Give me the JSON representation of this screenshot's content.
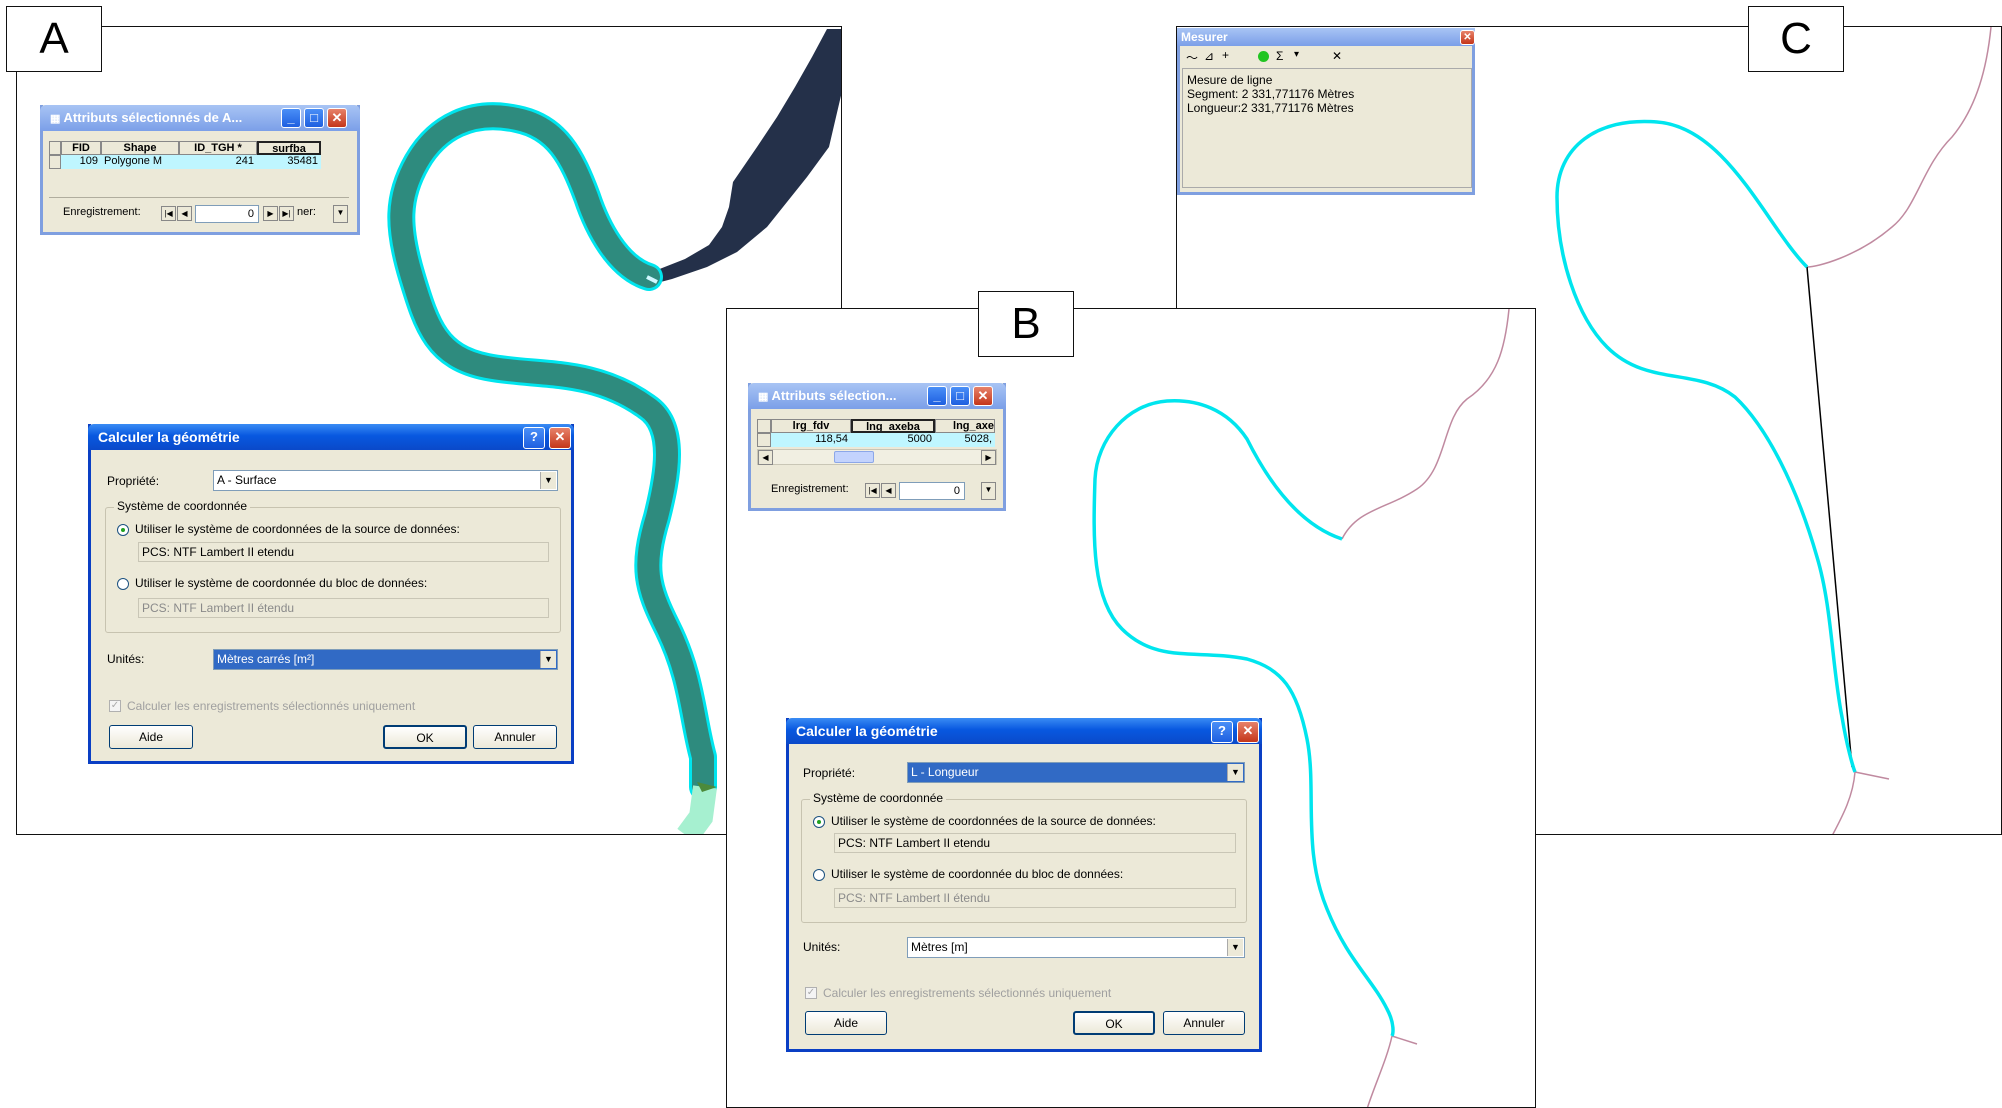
{
  "panels": {
    "a": {
      "letter": "A"
    },
    "b": {
      "letter": "B"
    },
    "c": {
      "letter": "C"
    }
  },
  "attr_a": {
    "title": "Attributs sélectionnés de A...",
    "columns": [
      "FID",
      "Shape",
      "ID_TGH *",
      "surfba"
    ],
    "row": [
      "109",
      "Polygone M",
      "241",
      "35481"
    ],
    "record_label": "Enregistrement:",
    "record_value": "0",
    "tail_text": "ner:"
  },
  "attr_b": {
    "title": "Attributs sélection...",
    "columns": [
      "lrg_fdv",
      "lng_axeba",
      "lng_axe"
    ],
    "row": [
      "118,54",
      "5000",
      "5028,"
    ],
    "record_label": "Enregistrement:",
    "record_value": "0"
  },
  "calc_a": {
    "title": "Calculer la géométrie",
    "propriete_label": "Propriété:",
    "propriete_value": "A - Surface",
    "group_label": "Système de coordonnée",
    "radio1_label": "Utiliser le système de coordonnées de la source de données:",
    "radio1_value": "PCS: NTF Lambert II etendu",
    "radio2_label": "Utiliser le système de coordonnée du bloc de données:",
    "radio2_value": "PCS: NTF Lambert II étendu",
    "units_label": "Unités:",
    "units_value": "Mètres carrés [m²]",
    "checkbox_label": "Calculer les enregistrements sélectionnés uniquement",
    "aide": "Aide",
    "ok": "OK",
    "annuler": "Annuler"
  },
  "calc_b": {
    "title": "Calculer la géométrie",
    "propriete_label": "Propriété:",
    "propriete_value": "L - Longueur",
    "group_label": "Système de coordonnée",
    "radio1_label": "Utiliser le système de coordonnées de la source de données:",
    "radio1_value": "PCS: NTF Lambert II etendu",
    "radio2_label": "Utiliser le système de coordonnée du bloc de données:",
    "radio2_value": "PCS: NTF Lambert II étendu",
    "units_label": "Unités:",
    "units_value": "Mètres [m]",
    "checkbox_label": "Calculer les enregistrements sélectionnés uniquement",
    "aide": "Aide",
    "ok": "OK",
    "annuler": "Annuler"
  },
  "mesurer": {
    "title": "Mesurer",
    "line1": "Mesure de ligne",
    "line2": "Segment: 2 331,771176 Mètres",
    "line3": "Longueur:2 331,771176 Mètres"
  },
  "colors": {
    "river_dark": "#243049",
    "channel_fill": "#2e8b7e",
    "selection_outline": "#00e5ee",
    "pale_channel": "#a6f0d0",
    "pink_line": "#c08aa0"
  }
}
